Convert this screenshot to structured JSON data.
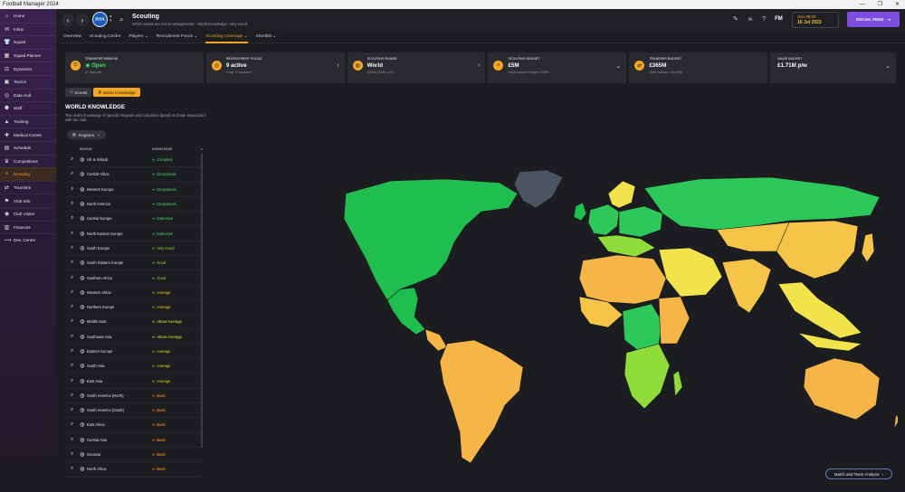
{
  "window": {
    "title": "Football Manager 2024",
    "controls": [
      "—",
      "❐",
      "✕"
    ]
  },
  "sidebar": {
    "items": [
      {
        "label": "Home",
        "icon": "home-icon",
        "glyph": "⌂"
      },
      {
        "label": "Inbox",
        "icon": "inbox-icon",
        "glyph": "✉"
      },
      {
        "label": "Squad",
        "icon": "shirt-icon",
        "glyph": "👕"
      },
      {
        "label": "Squad Planner",
        "icon": "planner-icon",
        "glyph": "▦"
      },
      {
        "label": "Dynamics",
        "icon": "dynamics-icon",
        "glyph": "⚖"
      },
      {
        "label": "Tactics",
        "icon": "tactics-icon",
        "glyph": "▣"
      },
      {
        "label": "Data Hub",
        "icon": "data-hub-icon",
        "glyph": "◎"
      },
      {
        "label": "Staff",
        "icon": "staff-icon",
        "glyph": "⚉"
      },
      {
        "label": "Training",
        "icon": "training-icon",
        "glyph": "▲"
      },
      {
        "label": "Medical Centre",
        "icon": "medical-icon",
        "glyph": "✚"
      },
      {
        "label": "Schedule",
        "icon": "schedule-icon",
        "glyph": "▤"
      },
      {
        "label": "Competitions",
        "icon": "trophy-icon",
        "glyph": "♛"
      },
      {
        "label": "Scouting",
        "icon": "scouting-icon",
        "glyph": "⌕",
        "active": true
      },
      {
        "label": "Transfers",
        "icon": "transfers-icon",
        "glyph": "⇄"
      },
      {
        "label": "Club Info",
        "icon": "club-info-icon",
        "glyph": "⚑"
      },
      {
        "label": "Club Vision",
        "icon": "club-vision-icon",
        "glyph": "◉"
      },
      {
        "label": "Finances",
        "icon": "finances-icon",
        "glyph": "▥"
      },
      {
        "label": "Dev. Centre",
        "icon": "dev-centre-icon",
        "glyph": "⟿"
      }
    ]
  },
  "header": {
    "club_badge_text": "BHA",
    "title": "Scouting",
    "subtitle": "10/10 scouts are out on assignments · World Knowledge: Very Good",
    "fm_label": "FM",
    "date_time": "Sun 08:00",
    "date_day": "16 Jul 2023",
    "social_feed": "SOCIAL FEED"
  },
  "subtabs": [
    {
      "label": "Overview"
    },
    {
      "label": "Scouting Centre"
    },
    {
      "label": "Players ⌄"
    },
    {
      "label": "Recruitment Focus ⌄"
    },
    {
      "label": "Scouting Coverage ⌄",
      "active": true
    },
    {
      "label": "Shortlist ⌄"
    }
  ],
  "cards": [
    {
      "label": "TRANSFER WINDOW",
      "value": "◉ Open",
      "sub": "47 days left",
      "glyph": "⏲",
      "value_color": "#4cd964",
      "chev": ""
    },
    {
      "label": "RECRUITMENT FOCUS",
      "value": "9 active",
      "sub": "0 top / 0 standard",
      "glyph": "◎",
      "value_color": "#ffffff",
      "chev": "›"
    },
    {
      "label": "SCOUTING RANGE",
      "value": "World",
      "sub": "£380K (£38K p/m)",
      "glyph": "◍",
      "value_color": "#ffffff",
      "chev": "›"
    },
    {
      "label": "SCOUTING BUDGET",
      "value": "£5M",
      "sub": "Initial season budget: £390K",
      "glyph": "⌕",
      "value_color": "#ffffff",
      "chev": "⌄"
    },
    {
      "label": "TRANSFER BUDGET",
      "value": "£365M",
      "sub": "Start Season: £40.98M",
      "glyph": "⇄",
      "value_color": "#ffffff",
      "chev": ""
    },
    {
      "label": "WAGE BUDGET",
      "value": "£1.71M p/w",
      "sub": "",
      "glyph": "",
      "value_color": "#ffffff",
      "chev": "⌄"
    }
  ],
  "toggle": {
    "scouts": "Scouts",
    "world": "World Knowledge"
  },
  "world_knowledge": {
    "title": "WORLD KNOWLEDGE",
    "description": "The club's knowledge of specific Regions and Countries based on those associated with the club.",
    "dropdown": "Regions"
  },
  "table": {
    "col_region": "REGION",
    "col_knowledge": "KNOWLEDGE",
    "rows": [
      {
        "region": "UK & Ireland",
        "knowledge": "Complete",
        "color": "#4cd964"
      },
      {
        "region": "Central Africa",
        "knowledge": "Exceptional",
        "color": "#4cd964"
      },
      {
        "region": "Western Europe",
        "knowledge": "Exceptional",
        "color": "#4cd964"
      },
      {
        "region": "North America",
        "knowledge": "Exceptional",
        "color": "#4cd964"
      },
      {
        "region": "Central Europe",
        "knowledge": "Extensive",
        "color": "#4cd964"
      },
      {
        "region": "North Eastern Europe",
        "knowledge": "Extensive",
        "color": "#4cd964"
      },
      {
        "region": "South Europe",
        "knowledge": "Very Good",
        "color": "#8fdc3a"
      },
      {
        "region": "South Eastern Europe",
        "knowledge": "Good",
        "color": "#8fdc3a"
      },
      {
        "region": "Southern Africa",
        "knowledge": "Good",
        "color": "#8fdc3a"
      },
      {
        "region": "Western Africa",
        "knowledge": "Average",
        "color": "#f5c02a"
      },
      {
        "region": "Northern Europe",
        "knowledge": "Average",
        "color": "#f5c02a"
      },
      {
        "region": "Middle East",
        "knowledge": "Above Average",
        "color": "#e8e04a"
      },
      {
        "region": "Southeast Asia",
        "knowledge": "Above Average",
        "color": "#e8e04a"
      },
      {
        "region": "Eastern Europe",
        "knowledge": "Average",
        "color": "#f5c02a"
      },
      {
        "region": "South Asia",
        "knowledge": "Average",
        "color": "#f5c02a"
      },
      {
        "region": "East Asia",
        "knowledge": "Average",
        "color": "#f5c02a"
      },
      {
        "region": "South America (North)",
        "knowledge": "Basic",
        "color": "#f5a623"
      },
      {
        "region": "South America (South)",
        "knowledge": "Basic",
        "color": "#f5a623"
      },
      {
        "region": "East Africa",
        "knowledge": "Basic",
        "color": "#f5a623"
      },
      {
        "region": "Central Asia",
        "knowledge": "Basic",
        "color": "#f5a623"
      },
      {
        "region": "Oceania",
        "knowledge": "Basic",
        "color": "#f5a623"
      },
      {
        "region": "North Africa",
        "knowledge": "Basic",
        "color": "#f5a623"
      }
    ]
  },
  "map_colors": {
    "complete": "#1fbe4e",
    "exceptional": "#2ec85a",
    "good": "#8fdc3a",
    "above_average": "#f2e34c",
    "average": "#f7c44a",
    "basic": "#f5b547",
    "unknown": "#4a5561"
  },
  "match_button": "Match and Team Analysis"
}
